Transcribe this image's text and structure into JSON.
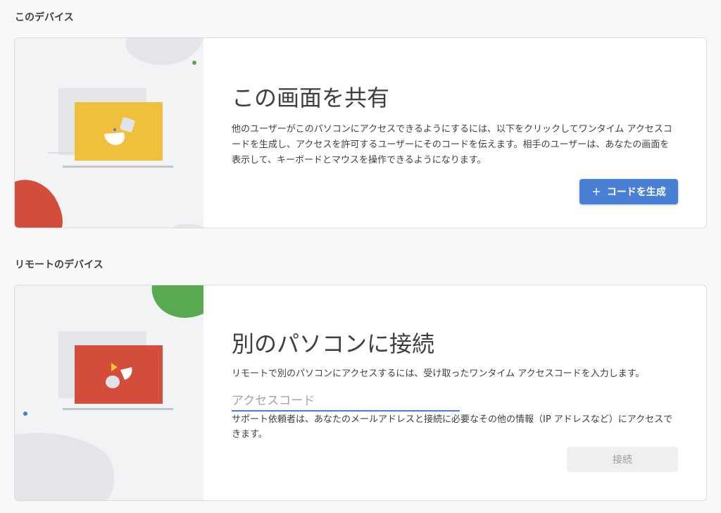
{
  "this_device": {
    "section_title": "このデバイス",
    "heading": "この画面を共有",
    "description": "他のユーザーがこのパソコンにアクセスできるようにするには、以下をクリックしてワンタイム アクセスコードを生成し、アクセスを許可するユーザーにそのコードを伝えます。相手のユーザーは、あなたの画面を表示して、キーボードとマウスを操作できるようになります。",
    "generate_button_label": "コードを生成",
    "generate_button_icon": "plus-icon",
    "illustration_color": "#f0bf3c"
  },
  "remote_device": {
    "section_title": "リモートのデバイス",
    "heading": "別のパソコンに接続",
    "description": "リモートで別のパソコンにアクセスするには、受け取ったワンタイム アクセスコードを入力します。",
    "access_code_value": "",
    "access_code_placeholder": "アクセスコード",
    "help_text": "サポート依頼者は、あなたのメールアドレスと接続に必要なその他の情報（IP アドレスなど）にアクセスできます。",
    "connect_button_label": "接続",
    "illustration_color": "#d24e3b"
  },
  "colors": {
    "accent": "#4a7fd6",
    "yellow": "#f0bf3c",
    "red": "#d24e3b",
    "green": "#58a94f",
    "background": "#f8f8f8"
  }
}
